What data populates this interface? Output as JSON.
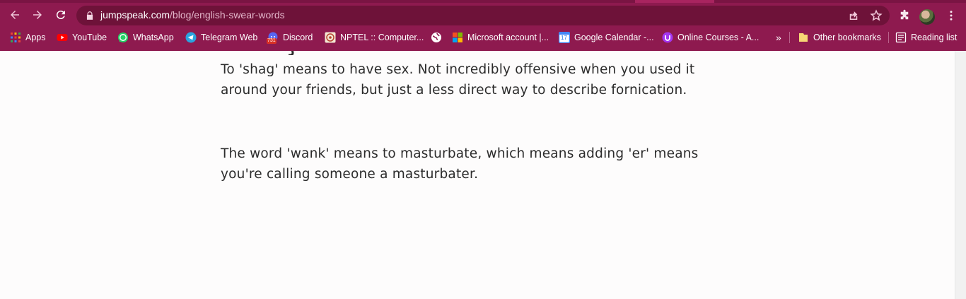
{
  "browser": {
    "url": {
      "host": "jumpspeak.com",
      "path": "/blog/english-swear-words"
    },
    "icons": {
      "back": "back-arrow-icon",
      "forward": "forward-arrow-icon",
      "reload": "reload-icon",
      "lock": "lock-icon",
      "share": "share-icon",
      "bookmark_star": "star-icon",
      "extensions": "puzzle-icon",
      "menu": "kebab-menu-icon"
    },
    "colors": {
      "frame": "#8e1a4f",
      "omnibox": "#6e1239",
      "page_background": "#fdfcfc",
      "text": "#2c2c2c"
    }
  },
  "bookmarks_bar": {
    "items": [
      {
        "label": "Apps",
        "icon": "apps-grid-icon"
      },
      {
        "label": "YouTube",
        "icon": "youtube-icon"
      },
      {
        "label": "WhatsApp",
        "icon": "whatsapp-icon"
      },
      {
        "label": "Telegram Web",
        "icon": "telegram-icon"
      },
      {
        "label": "Discord",
        "icon": "discord-icon"
      },
      {
        "label": "NPTEL :: Computer...",
        "icon": "nptel-icon"
      },
      {
        "label": "",
        "icon": "globe-icon"
      },
      {
        "label": "Microsoft account |...",
        "icon": "microsoft-icon"
      },
      {
        "label": "Google Calendar -...",
        "icon": "calendar-icon"
      },
      {
        "label": "Online Courses - A...",
        "icon": "online-courses-icon"
      }
    ],
    "overflow": "»",
    "other_bookmarks": "Other bookmarks",
    "reading_list": "Reading list",
    "discord_badge": "731",
    "calendar_day": "17"
  },
  "article": {
    "paragraphs": [
      {
        "lines": [
          "To 'shag' means to have sex. Not incredibly offensive when you used it",
          "around your friends, but just a less direct way to describe fornication."
        ]
      },
      {
        "lines": [
          "The word 'wank' means to masturbate, which means adding 'er' means",
          "you're calling someone a masturbater."
        ]
      }
    ]
  }
}
